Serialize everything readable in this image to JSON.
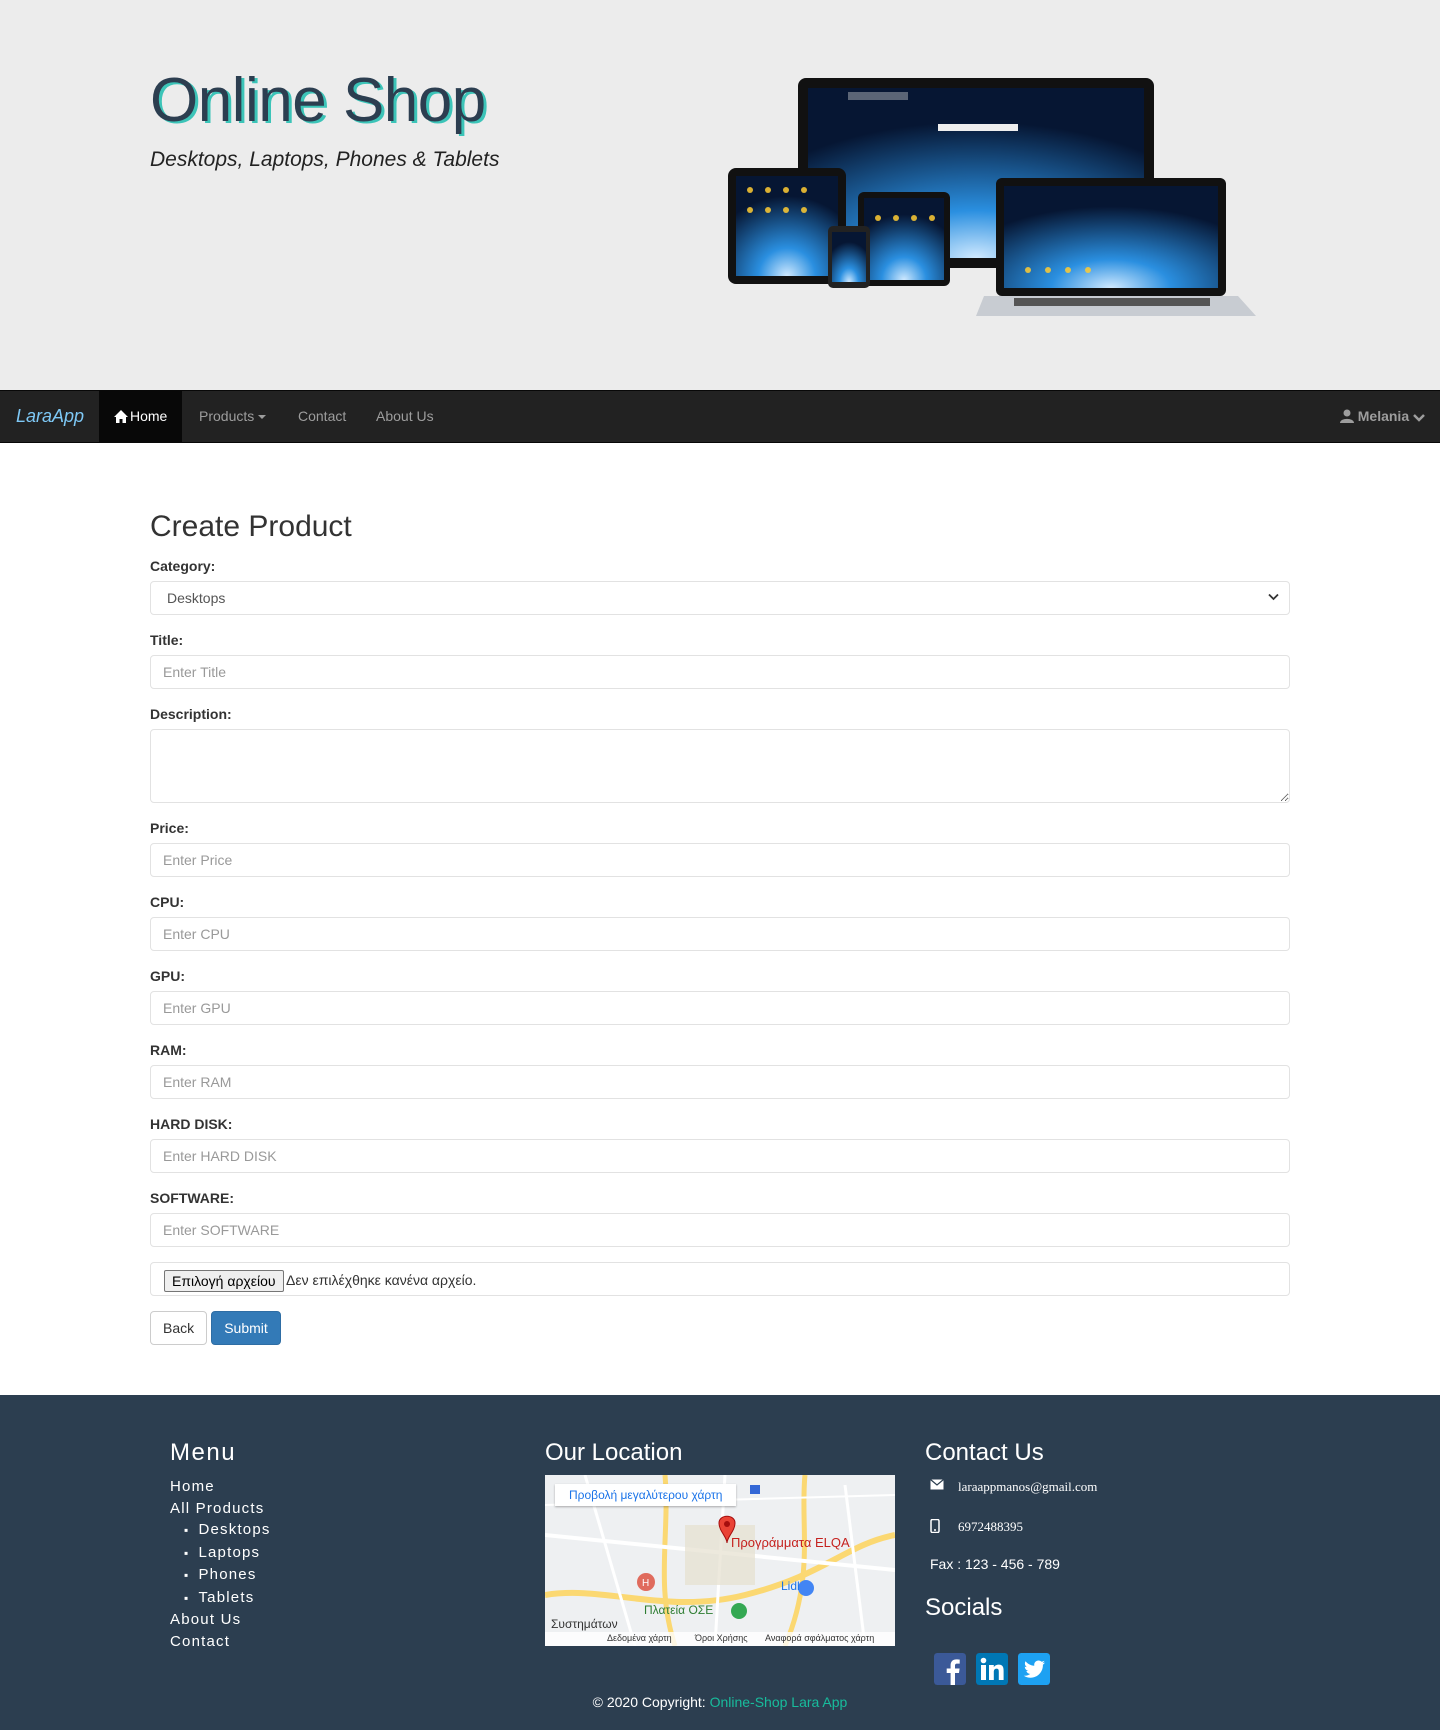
{
  "hero": {
    "title": "Online Shop",
    "subtitle": "Desktops, Laptops, Phones & Tablets"
  },
  "navbar": {
    "brand": "LaraApp",
    "home": "Home",
    "products": "Products",
    "contact": "Contact",
    "about": "About Us",
    "user": "Melania",
    "home_icon": "home-icon",
    "user_icon": "user-icon"
  },
  "form": {
    "heading": "Create Product",
    "category_label": "Category:",
    "category_value": "Desktops",
    "title_label": "Title:",
    "title_placeholder": "Enter Title",
    "description_label": "Description:",
    "price_label": "Price:",
    "price_placeholder": "Enter Price",
    "cpu_label": "CPU:",
    "cpu_placeholder": "Enter CPU",
    "gpu_label": "GPU:",
    "gpu_placeholder": "Enter GPU",
    "ram_label": "RAM:",
    "ram_placeholder": "Enter RAM",
    "hdd_label": "HARD DISK:",
    "hdd_placeholder": "Enter HARD DISK",
    "software_label": "SOFTWARE:",
    "software_placeholder": "Enter SOFTWARE",
    "file_button": "Επιλογή αρχείου",
    "file_status": "Δεν επιλέχθηκε κανένα αρχείο.",
    "back_label": "Back",
    "submit_label": "Submit"
  },
  "footer": {
    "menu_heading": "Menu",
    "menu": {
      "home": "Home",
      "all_products": "All Products",
      "sub": [
        "Desktops",
        "Laptops",
        "Phones",
        "Tablets"
      ],
      "about": "About Us",
      "contact": "Contact"
    },
    "location_heading": "Our Location",
    "map": {
      "banner": "Προβολή μεγαλύτερου χάρτη",
      "pin_label": "Προγράμματα ELQA",
      "lidl": "Lidl",
      "platia": "Πλατεία ΟΣΕ",
      "systimaton": "Συστημάτων",
      "footer_data": "Δεδομένα χάρτη",
      "footer_terms": "Όροι Χρήσης",
      "footer_report": "Αναφορά σφάλματος χάρτη"
    },
    "contact_heading": "Contact Us",
    "email": "laraappmanos@gmail.com",
    "phone": "6972488395",
    "fax": "Fax : 123 - 456 - 789",
    "socials_heading": "Socials",
    "copyright_prefix": "© 2020 Copyright: ",
    "copyright_link": "Online-Shop Lara App"
  },
  "colors": {
    "navbar": "#222222",
    "footer": "#2c3e50",
    "accent_teal": "#18bc9c",
    "primary": "#337ab7"
  }
}
